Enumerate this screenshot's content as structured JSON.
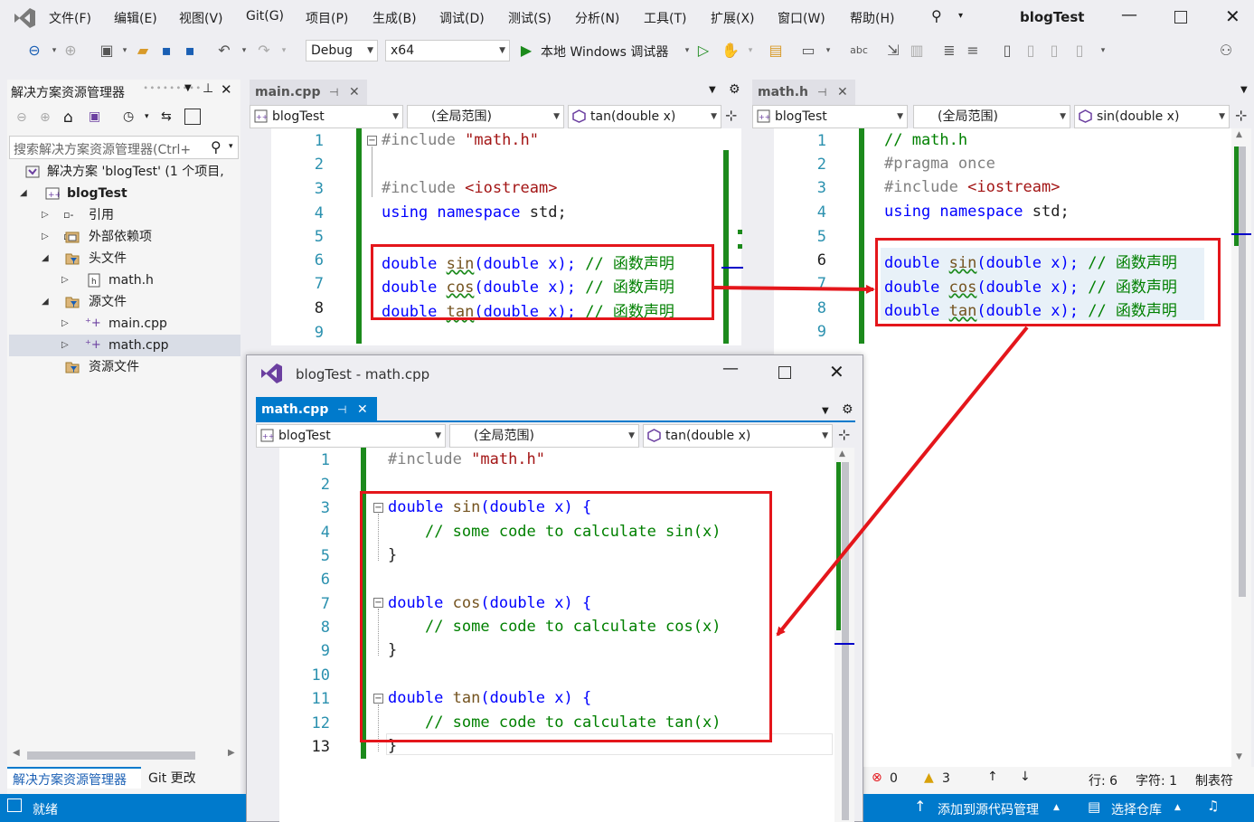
{
  "menu": [
    "文件(F)",
    "编辑(E)",
    "视图(V)",
    "Git(G)",
    "项目(P)",
    "生成(B)",
    "调试(D)",
    "测试(S)",
    "分析(N)",
    "工具(T)",
    "扩展(X)",
    "窗口(W)",
    "帮助(H)"
  ],
  "window_title": "blogTest",
  "toolbar": {
    "config": "Debug",
    "platform": "x64",
    "run_label": "本地 Windows 调试器"
  },
  "solution_explorer": {
    "title": "解决方案资源管理器",
    "search_placeholder": "搜索解决方案资源管理器(Ctrl+",
    "items": [
      {
        "label": "解决方案 'blogTest' (1 个项目,"
      },
      {
        "label": "blogTest"
      },
      {
        "label": "引用"
      },
      {
        "label": "外部依赖项"
      },
      {
        "label": "头文件"
      },
      {
        "label": "math.h"
      },
      {
        "label": "源文件"
      },
      {
        "label": "main.cpp"
      },
      {
        "label": "math.cpp"
      },
      {
        "label": "资源文件"
      }
    ],
    "bottom_tabs": [
      "解决方案资源管理器",
      "Git 更改"
    ]
  },
  "main_editor": {
    "tab": "main.cpp",
    "project": "blogTest",
    "scope": "(全局范围)",
    "member": "tan(double x)",
    "line_numbers": [
      "1",
      "2",
      "3",
      "4",
      "5",
      "6",
      "7",
      "8",
      "9"
    ],
    "lines": [
      {
        "a": "#include ",
        "b": "\"math.h\"",
        "c": "",
        "d": ""
      },
      {
        "a": "",
        "b": "",
        "c": "",
        "d": ""
      },
      {
        "a": "#include ",
        "b": "<iostream>",
        "c": "",
        "d": ""
      },
      {
        "a": "using namespace ",
        "b": "std;",
        "c": "",
        "d": ""
      },
      {
        "a": "",
        "b": "",
        "c": "",
        "d": ""
      },
      {
        "a": "double ",
        "b": "sin",
        "c": "(double x); ",
        "d": "// 函数声明"
      },
      {
        "a": "double ",
        "b": "cos",
        "c": "(double x); ",
        "d": "// 函数声明"
      },
      {
        "a": "double ",
        "b": "tan",
        "c": "(double x); ",
        "d": "// 函数声明"
      },
      {
        "a": "",
        "b": "",
        "c": "",
        "d": ""
      }
    ]
  },
  "header_editor": {
    "tab": "math.h",
    "project": "blogTest",
    "scope": "(全局范围)",
    "member": "sin(double x)",
    "line_numbers": [
      "1",
      "2",
      "3",
      "4",
      "5",
      "6",
      "7",
      "8",
      "9"
    ],
    "lines": [
      {
        "a": "// math.h",
        "b": "",
        "c": "",
        "d": ""
      },
      {
        "a": "#pragma ",
        "b": "once",
        "c": "",
        "d": ""
      },
      {
        "a": "#include ",
        "b": "<iostream>",
        "c": "",
        "d": ""
      },
      {
        "a": "using namespace ",
        "b": "std;",
        "c": "",
        "d": ""
      },
      {
        "a": "",
        "b": "",
        "c": "",
        "d": ""
      },
      {
        "a": "double ",
        "b": "sin",
        "c": "(double x); ",
        "d": "// 函数声明"
      },
      {
        "a": "double ",
        "b": "cos",
        "c": "(double x); ",
        "d": "// 函数声明"
      },
      {
        "a": "double ",
        "b": "tan",
        "c": "(double x); ",
        "d": "// 函数声明"
      },
      {
        "a": "",
        "b": "",
        "c": "",
        "d": ""
      }
    ]
  },
  "float_window": {
    "title": "blogTest - math.cpp",
    "tab": "math.cpp",
    "project": "blogTest",
    "scope": "(全局范围)",
    "member": "tan(double x)",
    "line_numbers": [
      "1",
      "2",
      "3",
      "4",
      "5",
      "6",
      "7",
      "8",
      "9",
      "10",
      "11",
      "12",
      "13"
    ],
    "lines": [
      {
        "a": "#include ",
        "b": "\"math.h\"",
        "c": "",
        "d": ""
      },
      {
        "a": "",
        "b": "",
        "c": "",
        "d": ""
      },
      {
        "a": "double ",
        "b": "sin",
        "c": "(double x) {",
        "d": ""
      },
      {
        "a": "    ",
        "b": "",
        "c": "",
        "d": "// some code to calculate sin(x)"
      },
      {
        "a": "}",
        "b": "",
        "c": "",
        "d": ""
      },
      {
        "a": "",
        "b": "",
        "c": "",
        "d": ""
      },
      {
        "a": "double ",
        "b": "cos",
        "c": "(double x) {",
        "d": ""
      },
      {
        "a": "    ",
        "b": "",
        "c": "",
        "d": "// some code to calculate cos(x)"
      },
      {
        "a": "}",
        "b": "",
        "c": "",
        "d": ""
      },
      {
        "a": "",
        "b": "",
        "c": "",
        "d": ""
      },
      {
        "a": "double ",
        "b": "tan",
        "c": "(double x) {",
        "d": ""
      },
      {
        "a": "    ",
        "b": "",
        "c": "",
        "d": "// some code to calculate tan(x)"
      },
      {
        "a": "}",
        "b": "",
        "c": "",
        "d": ""
      }
    ]
  },
  "status": {
    "ready": "就绪",
    "errors": "0",
    "warnings": "3",
    "line": "行: 6",
    "char": "字符: 1",
    "tabs": "制表符",
    "add_source": "添加到源代码管理",
    "select_repo": "选择仓库"
  },
  "colors": {
    "accent": "#007acc",
    "annotation": "#e4161b",
    "change_bar": "#1c8a1c"
  }
}
